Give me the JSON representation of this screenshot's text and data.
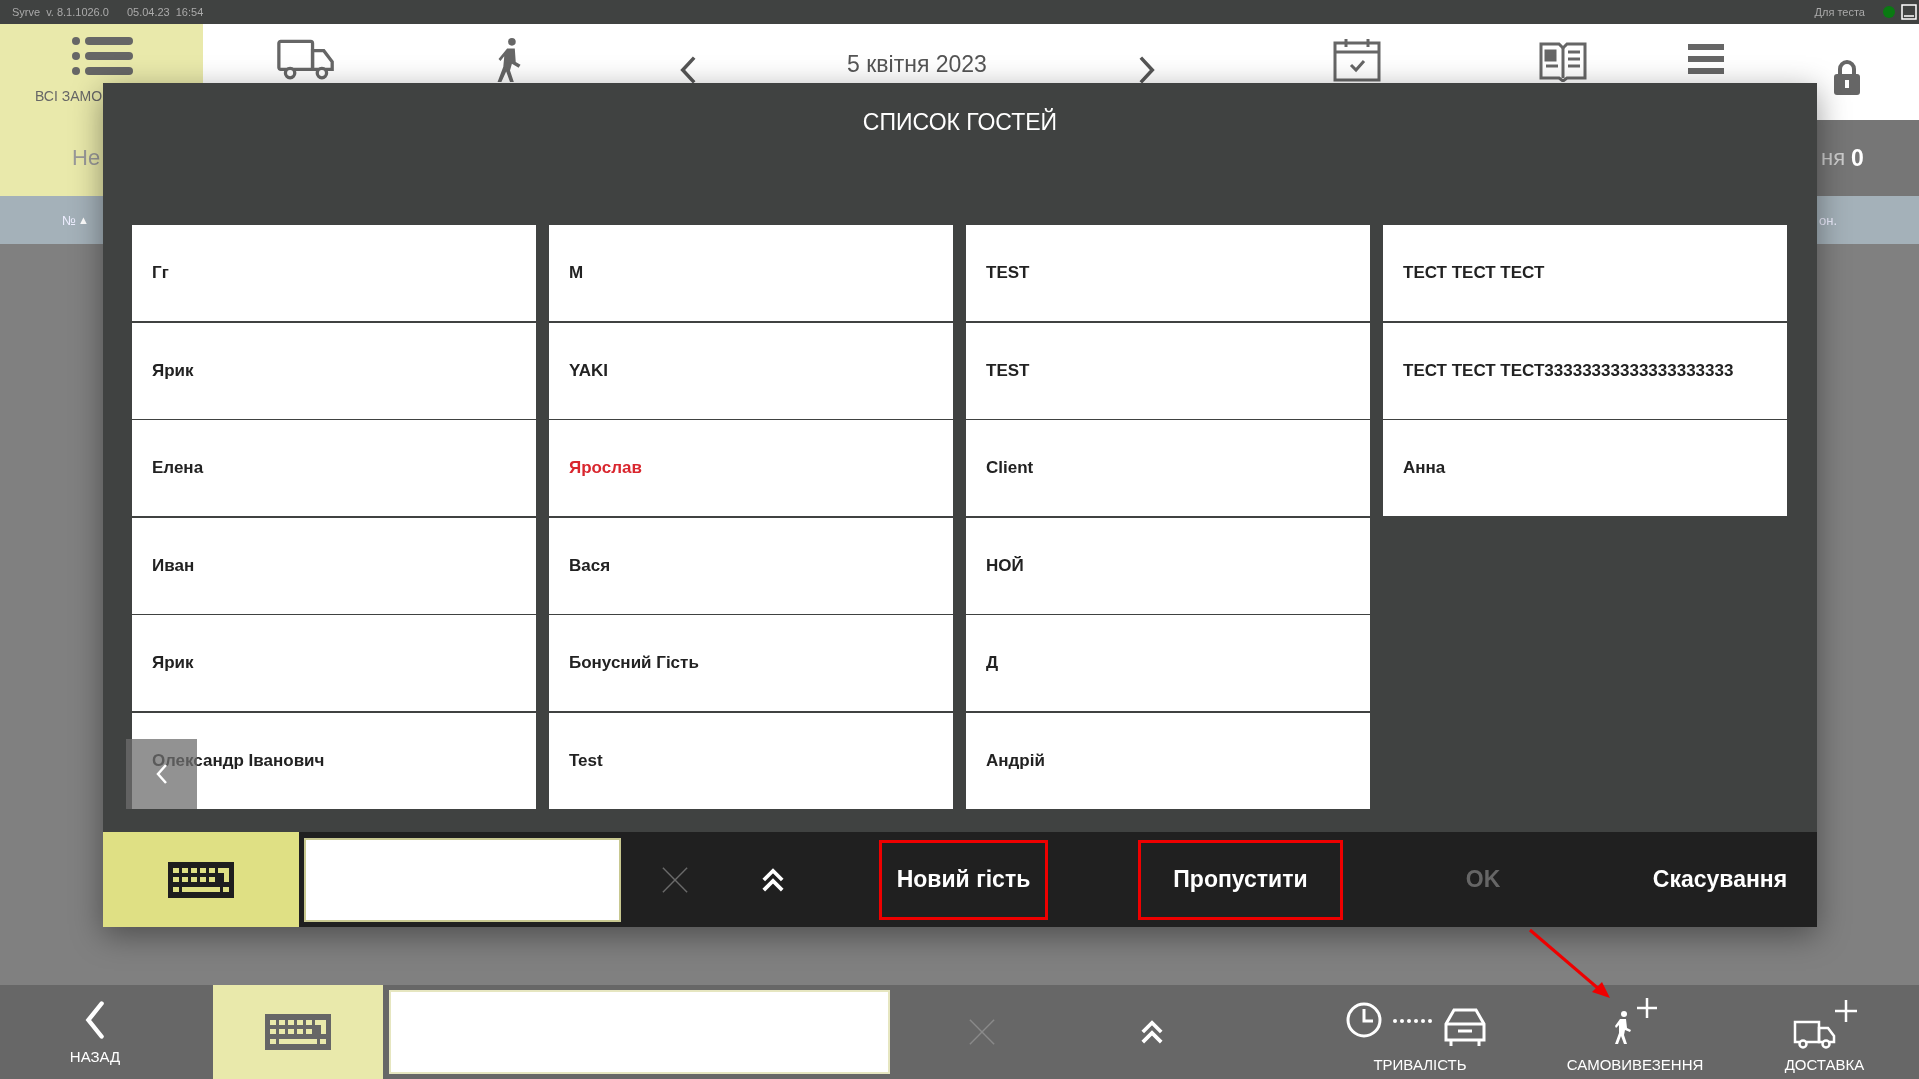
{
  "status_bar": {
    "app": "Syrve",
    "version": "v. 8.1.1026.0",
    "date": "05.04.23",
    "time": "16:54",
    "environment": "Для теста"
  },
  "header": {
    "all_orders_label": "ВСІ ЗАМО",
    "date": "5 квітня 2023"
  },
  "background": {
    "left_label": "Не",
    "right_label": "ня",
    "right_count": "0",
    "sort_column": "№",
    "sort_arrow": "▲",
    "right_column": "он."
  },
  "dialog": {
    "title": "СПИСОК ГОСТЕЙ",
    "guest_columns": [
      [
        {
          "name": "Гг",
          "highlighted": false
        },
        {
          "name": "Ярик",
          "highlighted": false
        },
        {
          "name": "Елена",
          "highlighted": false
        },
        {
          "name": "Иван",
          "highlighted": false
        },
        {
          "name": "Ярик",
          "highlighted": false
        },
        {
          "name": "Олександр Іванович",
          "highlighted": false
        }
      ],
      [
        {
          "name": "М",
          "highlighted": false
        },
        {
          "name": "YAKI",
          "highlighted": false
        },
        {
          "name": "Ярослав",
          "highlighted": true
        },
        {
          "name": "Вася",
          "highlighted": false
        },
        {
          "name": "Бонусний Гість",
          "highlighted": false
        },
        {
          "name": "Test",
          "highlighted": false
        }
      ],
      [
        {
          "name": "TEST",
          "highlighted": false
        },
        {
          "name": "TEST",
          "highlighted": false
        },
        {
          "name": "Client",
          "highlighted": false
        },
        {
          "name": "НОЙ",
          "highlighted": false
        },
        {
          "name": "Д",
          "highlighted": false
        },
        {
          "name": "Андрій",
          "highlighted": false
        }
      ],
      [
        {
          "name": "ТЕСТ ТЕСТ ТЕСТ",
          "highlighted": false
        },
        {
          "name": "ТЕСТ ТЕСТ ТЕСТ33333333333333333333",
          "highlighted": false
        },
        {
          "name": "Анна",
          "highlighted": false
        }
      ]
    ],
    "actions": [
      {
        "label": "Новий гість",
        "annotated": true,
        "disabled": false
      },
      {
        "label": "Пропустити",
        "annotated": true,
        "disabled": false
      },
      {
        "label": "OK",
        "annotated": false,
        "disabled": true
      },
      {
        "label": "Скасування",
        "annotated": false,
        "disabled": false
      }
    ]
  },
  "bottom_bar": {
    "back_label": "НАЗАД",
    "actions": [
      {
        "kind": "duration",
        "label": "ТРИВАЛІСТЬ"
      },
      {
        "kind": "pickup",
        "label": "САМОВИВЕЗЕННЯ"
      },
      {
        "kind": "delivery",
        "label": "ДОСТАВКА"
      }
    ]
  }
}
